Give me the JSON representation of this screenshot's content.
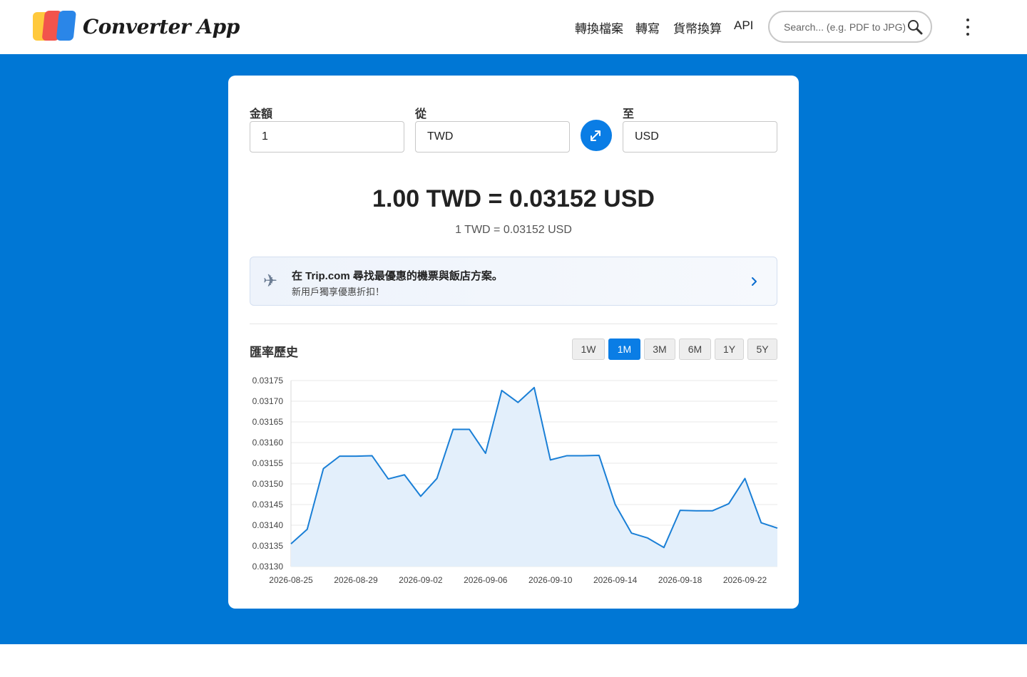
{
  "header": {
    "logo_text": "Converter App",
    "nav": [
      {
        "label": "轉換檔案"
      },
      {
        "label": "轉寫"
      },
      {
        "label": "貨幣換算"
      },
      {
        "label": "API"
      }
    ],
    "search_placeholder": "Search... (e.g. PDF to JPG)"
  },
  "converter": {
    "amount_label": "金額",
    "amount_value": "1",
    "from_label": "從",
    "from_value": "TWD",
    "to_label": "至",
    "to_value": "USD",
    "result": "1.00 TWD = 0.03152 USD",
    "result_sub": "1 TWD = 0.03152 USD"
  },
  "promo": {
    "title": "在 Trip.com 尋找最優惠的機票與飯店方案。",
    "subtitle": "新用戶獨享優惠折扣！"
  },
  "history": {
    "title": "匯率歷史",
    "ranges": [
      {
        "label": "1W",
        "active": false
      },
      {
        "label": "1M",
        "active": true
      },
      {
        "label": "3M",
        "active": false
      },
      {
        "label": "6M",
        "active": false
      },
      {
        "label": "1Y",
        "active": false
      },
      {
        "label": "5Y",
        "active": false
      }
    ]
  },
  "colors": {
    "brand_blue": "#0077d5",
    "accent": "#0a7de5",
    "line": "#1a7fd6",
    "area": "#e3effb"
  },
  "chart_data": {
    "type": "area",
    "x": [
      "2026-08-25",
      "2026-08-26",
      "2026-08-27",
      "2026-08-28",
      "2026-08-29",
      "2026-08-30",
      "2026-08-31",
      "2026-09-01",
      "2026-09-02",
      "2026-09-03",
      "2026-09-04",
      "2026-09-05",
      "2026-09-06",
      "2026-09-07",
      "2026-09-08",
      "2026-09-09",
      "2026-09-10",
      "2026-09-11",
      "2026-09-12",
      "2026-09-13",
      "2026-09-14",
      "2026-09-15",
      "2026-09-16",
      "2026-09-17",
      "2026-09-18",
      "2026-09-19",
      "2026-09-20",
      "2026-09-21",
      "2026-09-22",
      "2026-09-23",
      "2026-09-24"
    ],
    "values": [
      0.031355,
      0.03139,
      0.031537,
      0.031567,
      0.031567,
      0.031568,
      0.031512,
      0.031522,
      0.03147,
      0.031513,
      0.031632,
      0.031632,
      0.031574,
      0.031726,
      0.031697,
      0.031733,
      0.031558,
      0.031568,
      0.031568,
      0.031569,
      0.03145,
      0.031381,
      0.031369,
      0.031346,
      0.031436,
      0.031435,
      0.031435,
      0.031452,
      0.031513,
      0.031406,
      0.031393
    ],
    "xticks": [
      "2026-08-25",
      "2026-08-29",
      "2026-09-02",
      "2026-09-06",
      "2026-09-10",
      "2026-09-14",
      "2026-09-18",
      "2026-09-22"
    ],
    "yticks": [
      "0.03130",
      "0.03135",
      "0.03140",
      "0.03145",
      "0.03150",
      "0.03155",
      "0.03160",
      "0.03165",
      "0.03170",
      "0.03175"
    ],
    "ylim": [
      0.0313,
      0.03175
    ],
    "grid": true
  }
}
